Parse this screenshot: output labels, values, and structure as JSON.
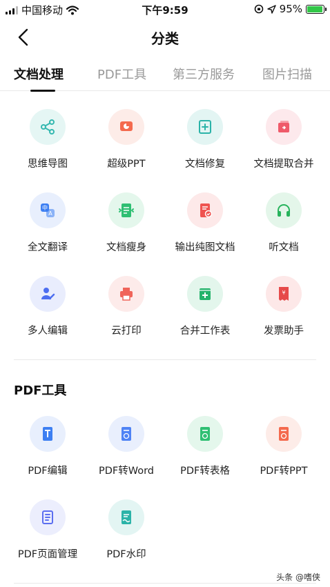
{
  "status_bar": {
    "carrier": "中国移动",
    "time": "下午9:59",
    "battery_pct": "95%",
    "battery_level": 0.95
  },
  "nav": {
    "title": "分类"
  },
  "tabs": [
    {
      "label": "文档处理"
    },
    {
      "label": "PDF工具"
    },
    {
      "label": "第三方服务"
    },
    {
      "label": "图片扫描"
    }
  ],
  "doc_tools": [
    {
      "label": "思维导图",
      "icon": "mindmap-icon",
      "color": "#34b8b0",
      "bg": "#e5f6f4"
    },
    {
      "label": "超级PPT",
      "icon": "ppt-icon",
      "color": "#f46a4e",
      "bg": "#fdece8"
    },
    {
      "label": "文档修复",
      "icon": "doc-repair-icon",
      "color": "#2bb3a8",
      "bg": "#e3f5f3"
    },
    {
      "label": "文档提取合并",
      "icon": "doc-merge-icon",
      "color": "#ef5a6a",
      "bg": "#fde9ec"
    },
    {
      "label": "全文翻译",
      "icon": "translate-icon",
      "color": "#3d7ff2",
      "bg": "#e8effd"
    },
    {
      "label": "文档瘦身",
      "icon": "doc-slim-icon",
      "color": "#2fbf73",
      "bg": "#e4f7ec"
    },
    {
      "label": "输出纯图文档",
      "icon": "image-doc-icon",
      "color": "#ef5350",
      "bg": "#fde9e9"
    },
    {
      "label": "听文档",
      "icon": "headphones-icon",
      "color": "#27b35c",
      "bg": "#e4f6ea"
    },
    {
      "label": "多人编辑",
      "icon": "multi-edit-icon",
      "color": "#4d6ef0",
      "bg": "#e9edfd"
    },
    {
      "label": "云打印",
      "icon": "printer-icon",
      "color": "#f0645a",
      "bg": "#fdebea"
    },
    {
      "label": "合并工作表",
      "icon": "merge-sheet-icon",
      "color": "#24b36b",
      "bg": "#e3f6ec"
    },
    {
      "label": "发票助手",
      "icon": "invoice-icon",
      "color": "#e64a4a",
      "bg": "#fde8e8"
    }
  ],
  "pdf_section": {
    "title": "PDF工具"
  },
  "pdf_tools": [
    {
      "label": "PDF编辑",
      "icon": "pdf-edit-icon",
      "color": "#3d7ff2",
      "bg": "#e8effd"
    },
    {
      "label": "PDF转Word",
      "icon": "pdf-to-word-icon",
      "color": "#4f83f5",
      "bg": "#e9effd"
    },
    {
      "label": "PDF转表格",
      "icon": "pdf-to-sheet-icon",
      "color": "#2fbf73",
      "bg": "#e4f7ec"
    },
    {
      "label": "PDF转PPT",
      "icon": "pdf-to-ppt-icon",
      "color": "#f46a4e",
      "bg": "#fdece8"
    },
    {
      "label": "PDF页面管理",
      "icon": "pdf-pages-icon",
      "color": "#5b6ef0",
      "bg": "#eceefd"
    },
    {
      "label": "PDF水印",
      "icon": "pdf-watermark-icon",
      "color": "#2bb3a8",
      "bg": "#e3f5f3"
    }
  ],
  "watermark": "头条 @嗜侠"
}
